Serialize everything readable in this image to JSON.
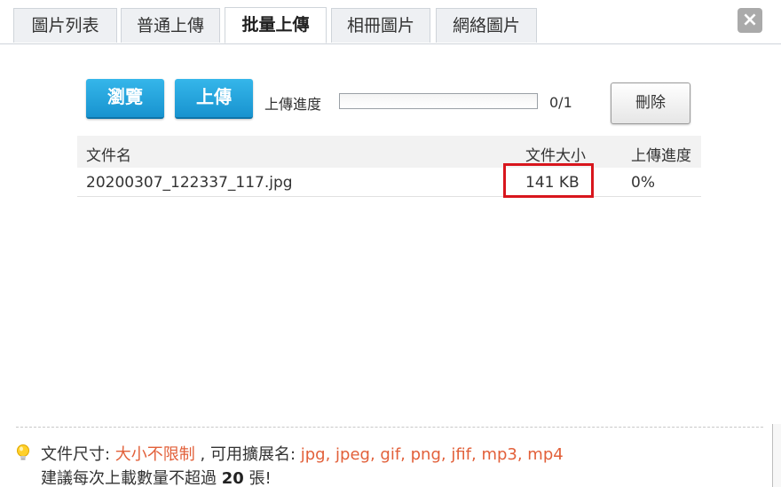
{
  "tabs": [
    {
      "label": "圖片列表",
      "active": false
    },
    {
      "label": "普通上傳",
      "active": false
    },
    {
      "label": "批量上傳",
      "active": true
    },
    {
      "label": "相冊圖片",
      "active": false
    },
    {
      "label": "網絡圖片",
      "active": false
    }
  ],
  "close": {
    "glyph": "×"
  },
  "toolbar": {
    "browse_label": "瀏覽",
    "upload_label": "上傳",
    "progress_label": "上傳進度",
    "progress_fraction": 0,
    "progress_count": "0/1",
    "delete_label": "刪除"
  },
  "table": {
    "headers": {
      "name": "文件名",
      "size": "文件大小",
      "progress": "上傳進度"
    },
    "rows": [
      {
        "name": "20200307_122337_117.jpg",
        "size": "141 KB",
        "progress": "0%"
      }
    ]
  },
  "footer": {
    "size_prefix": "文件尺寸: ",
    "size_value": "大小不限制",
    "ext_prefix": " , 可用擴展名: ",
    "ext_value": "jpg, jpeg, gif, png, jfif, mp3, mp4",
    "limit_prefix": "建議每次上載數量不超過 ",
    "limit_value": "20",
    "limit_suffix": " 張!"
  },
  "colors": {
    "accent": "#e2603a",
    "button_blue": "#1893cf",
    "highlight_red": "#d8161d"
  }
}
